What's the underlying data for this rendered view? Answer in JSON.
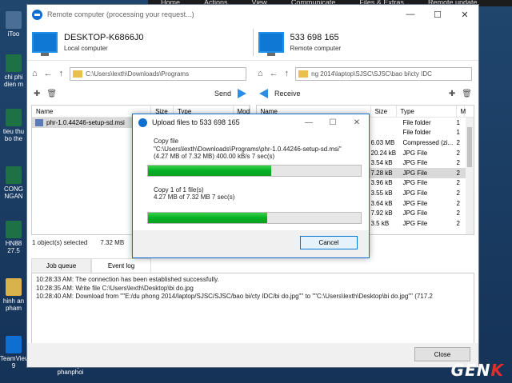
{
  "taskbar": [
    "Home",
    "Actions",
    "View",
    "Communicate",
    "Files & Extras",
    "Remote update"
  ],
  "desktop_icons": [
    "iToo",
    "chi phi\ndien m",
    "tieu thu\nbo the",
    "CONG\nNGAN",
    "HN88\n27.5",
    "hinh an\npham",
    "TeamViewer\n9",
    "Huong\nphanphoi"
  ],
  "window": {
    "title": "Remote computer (processing your request...)",
    "local": {
      "name": "DESKTOP-K6866J0",
      "sub": "Local computer"
    },
    "remote": {
      "name": "533 698 165",
      "sub": "Remote computer"
    },
    "local_path": "C:\\Users\\lexth\\Downloads\\Programs",
    "remote_path": "ng 2014\\laptop\\SJSC\\SJSC\\bao bi\\cty IDC",
    "send": "Send",
    "receive": "Receive",
    "left_headers": [
      "Name",
      "Size",
      "Type",
      "Mod"
    ],
    "right_headers": [
      "Name",
      "Size",
      "Type",
      "M"
    ],
    "left_rows": [
      {
        "name": "phr-1.0.44246-setup-sd.msi",
        "size": "",
        "type": ""
      }
    ],
    "right_rows": [
      {
        "size": "",
        "type": "File folder",
        "m": "1"
      },
      {
        "size": "",
        "type": "File folder",
        "m": "1"
      },
      {
        "size": "6.03 MB",
        "type": "Compressed (zi...",
        "m": "2"
      },
      {
        "size": "20.24 kB",
        "type": "JPG File",
        "m": "2"
      },
      {
        "size": "3.54 kB",
        "type": "JPG File",
        "m": "2"
      },
      {
        "size": "7.28 kB",
        "type": "JPG File",
        "m": "2"
      },
      {
        "size": "3.96 kB",
        "type": "JPG File",
        "m": "2"
      },
      {
        "size": "3.55 kB",
        "type": "JPG File",
        "m": "2"
      },
      {
        "size": "3.64 kB",
        "type": "JPG File",
        "m": "2"
      },
      {
        "size": "7.92 kB",
        "type": "JPG File",
        "m": "2"
      },
      {
        "size": "3.5 kB",
        "type": "JPG File",
        "m": "2"
      }
    ],
    "status_count": "1 object(s) selected",
    "status_size": "7.32 MB",
    "tab_job": "Job queue",
    "tab_event": "Event log",
    "log": [
      "10:28:33 AM: The connection has been established successfully.",
      "10:28:35 AM: Write file C:\\Users\\lexth\\Desktop\\bi do.jpg",
      "10:28:40 AM: Download from \"\"E:/du phong 2014/laptop/SJSC/SJSC/bao bi/cty IDC/bi do.jpg\"\" to \"\"C:\\Users\\lexth\\Desktop\\bi do.jpg\"\" (717.2"
    ],
    "close": "Close"
  },
  "dialog": {
    "title": "Upload files to 533 698 165",
    "copy_file": "Copy file",
    "file_path": "\"C:\\Users\\lexth\\Downloads\\Programs\\phr-1.0.44246-setup-sd.msi\"",
    "file_progress": "(4.27 MB of 7.32 MB)   400.00 kB/s   7 sec(s)",
    "progress1": 0.58,
    "copy_count": "Copy 1 of 1 file(s)",
    "total_progress": "4.27 MB of 7.32 MB   7 sec(s)",
    "progress2": 0.56,
    "cancel": "Cancel"
  },
  "watermark": {
    "a": "GEN",
    "b": "K"
  }
}
